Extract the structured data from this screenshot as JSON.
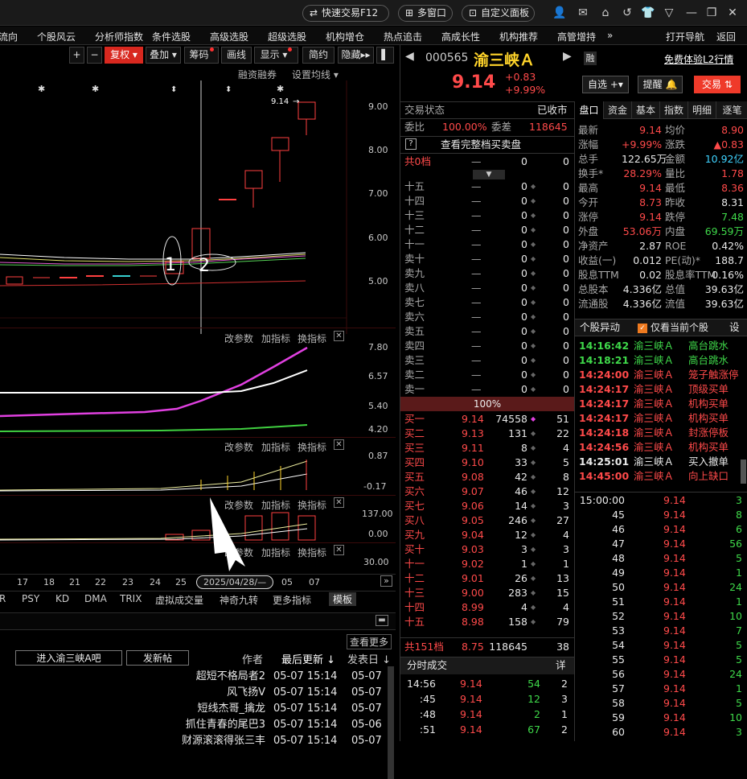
{
  "topbar": {
    "quick_trade": "快速交易F12",
    "multi_window": "多窗口",
    "custom_panel": "自定义面板"
  },
  "menu": [
    "流向",
    "个股风云",
    "分析师指数",
    "条件选股",
    "高级选股",
    "超级选股",
    "机构增仓",
    "热点追击",
    "高成长性",
    "机构推荐",
    "高管增持",
    "»",
    "打开导航",
    "返回"
  ],
  "chart_toolbar": {
    "plus": "+",
    "minus": "−",
    "fuquan": "复权",
    "diejia": "叠加",
    "chouma": "筹码",
    "huaxian": "画线",
    "xianshi": "显示",
    "jianyue": "简约",
    "yincang": "隐藏",
    "rzrq": "融资融券",
    "set_ma": "设置均线"
  },
  "price_axis": [
    "9.00",
    "8.00",
    "7.00",
    "6.00",
    "5.00"
  ],
  "last_price_label": "9.14",
  "annot": {
    "one": "1",
    "two": "2"
  },
  "sub1": {
    "params": "改参数",
    "add": "加指标",
    "swap": "换指标",
    "axis": [
      "7.80",
      "6.57",
      "5.40",
      "4.20"
    ]
  },
  "sub2": {
    "params": "改参数",
    "add": "加指标",
    "swap": "换指标",
    "axis": [
      "0.87",
      "-0.17"
    ]
  },
  "sub3": {
    "params": "改参数",
    "add": "加指标",
    "swap": "换指标",
    "axis": [
      "137.00",
      "0.00"
    ]
  },
  "sub4": {
    "params": "改参数",
    "add": "加指标",
    "swap": "换指标",
    "axis": [
      "30.00"
    ]
  },
  "dates": [
    "17",
    "18",
    "21",
    "22",
    "23",
    "24",
    "25",
    "05",
    "07"
  ],
  "cursor_date": "2025/04/28/—",
  "indicator_tabs": [
    "R",
    "PSY",
    "KD",
    "DMA",
    "TRIX",
    "虚拟成交量",
    "神奇九转",
    "更多指标",
    "模板"
  ],
  "forum": {
    "more": "查看更多",
    "enter": "进入渝三峡A吧",
    "post": "发新帖",
    "col_author": "作者",
    "col_update": "最后更新",
    "col_date": "发表日",
    "rows": [
      [
        "超短不格局者2",
        "05-07 15:14",
        "05-07"
      ],
      [
        "风飞扬V",
        "05-07 15:14",
        "05-07"
      ],
      [
        "短线杰哥_擒龙",
        "05-07 15:14",
        "05-07"
      ],
      [
        "抓住青春的尾巴3",
        "05-07 15:14",
        "05-06"
      ],
      [
        "财源滚滚得张三丰",
        "05-07 15:14",
        "05-07"
      ]
    ]
  },
  "stock": {
    "code": "000565",
    "name": "渝三峡Ａ",
    "price": "9.14",
    "change": "+0.83",
    "pct": "+9.99%",
    "rong": "融",
    "free_l2": "免费体验L2行情",
    "zixuan": "自选",
    "tixing": "提醒",
    "jiaoyi": "交易"
  },
  "trade_status": {
    "label": "交易状态",
    "value": "已收市"
  },
  "weibi": {
    "label": "委比",
    "value": "100.00%",
    "label2": "委差",
    "value2": "118645"
  },
  "full_book": "查看完整档买卖盘",
  "total_top": {
    "label": "共0档",
    "a": "—",
    "b": "0",
    "c": "0"
  },
  "sells": [
    [
      "十五",
      "—",
      "0",
      "0"
    ],
    [
      "十四",
      "—",
      "0",
      "0"
    ],
    [
      "十三",
      "—",
      "0",
      "0"
    ],
    [
      "十二",
      "—",
      "0",
      "0"
    ],
    [
      "十一",
      "—",
      "0",
      "0"
    ],
    [
      "卖十",
      "—",
      "0",
      "0"
    ],
    [
      "卖九",
      "—",
      "0",
      "0"
    ],
    [
      "卖八",
      "—",
      "0",
      "0"
    ],
    [
      "卖七",
      "—",
      "0",
      "0"
    ],
    [
      "卖六",
      "—",
      "0",
      "0"
    ],
    [
      "卖五",
      "—",
      "0",
      "0"
    ],
    [
      "卖四",
      "—",
      "0",
      "0"
    ],
    [
      "卖三",
      "—",
      "0",
      "0"
    ],
    [
      "卖二",
      "—",
      "0",
      "0"
    ],
    [
      "卖一",
      "—",
      "0",
      "0"
    ]
  ],
  "ratio_bar": "100%",
  "buys": [
    [
      "买一",
      "9.14",
      "74558",
      "51"
    ],
    [
      "买二",
      "9.13",
      "131",
      "22"
    ],
    [
      "买三",
      "9.11",
      "8",
      "4"
    ],
    [
      "买四",
      "9.10",
      "33",
      "5"
    ],
    [
      "买五",
      "9.08",
      "42",
      "8"
    ],
    [
      "买六",
      "9.07",
      "46",
      "12"
    ],
    [
      "买七",
      "9.06",
      "14",
      "3"
    ],
    [
      "买八",
      "9.05",
      "246",
      "27"
    ],
    [
      "买九",
      "9.04",
      "12",
      "4"
    ],
    [
      "买十",
      "9.03",
      "3",
      "3"
    ],
    [
      "十一",
      "9.02",
      "1",
      "1"
    ],
    [
      "十二",
      "9.01",
      "26",
      "13"
    ],
    [
      "十三",
      "9.00",
      "283",
      "15"
    ],
    [
      "十四",
      "8.99",
      "4",
      "4"
    ],
    [
      "十五",
      "8.98",
      "158",
      "79"
    ]
  ],
  "total_bottom": {
    "label": "共151档",
    "a": "8.75",
    "b": "118645",
    "c": "38"
  },
  "fenshi": {
    "title": "分时成交",
    "detail": "详",
    "rows": [
      [
        "14:56",
        "9.14",
        "54",
        "2"
      ],
      [
        ":45",
        "9.14",
        "12",
        "3"
      ],
      [
        ":48",
        "9.14",
        "2",
        "1"
      ],
      [
        ":51",
        "9.14",
        "67",
        "2"
      ]
    ]
  },
  "tabs": [
    "盘口",
    "资金",
    "基本",
    "指数",
    "明细",
    "逐笔"
  ],
  "quote": [
    [
      "最新",
      "9.14",
      "均价",
      "8.90"
    ],
    [
      "涨幅",
      "+9.99%",
      "涨跌",
      "▲0.83"
    ],
    [
      "总手",
      "122.65万",
      "金额",
      "10.92亿"
    ],
    [
      "换手*",
      "28.29%",
      "量比",
      "1.78"
    ],
    [
      "最高",
      "9.14",
      "最低",
      "8.36"
    ],
    [
      "今开",
      "8.73",
      "昨收",
      "8.31"
    ],
    [
      "涨停",
      "9.14",
      "跌停",
      "7.48"
    ],
    [
      "外盘",
      "53.06万",
      "内盘",
      "69.59万"
    ],
    [
      "净资产",
      "2.87",
      "ROE",
      "0.42%"
    ],
    [
      "收益(一)",
      "0.012",
      "PE(动)*",
      "188.7"
    ],
    [
      "股息TTM",
      "0.02",
      "股息率TTM",
      "0.16%"
    ],
    [
      "总股本",
      "4.336亿",
      "总值",
      "39.63亿"
    ],
    [
      "流通股",
      "4.336亿",
      "流值",
      "39.63亿"
    ]
  ],
  "anomaly": {
    "title": "个股异动",
    "only_current": "仅看当前个股",
    "settings": "设",
    "rows": [
      [
        "14:16:42",
        "渝三峡Ａ",
        "高台跳水"
      ],
      [
        "14:18:21",
        "渝三峡Ａ",
        "高台跳水"
      ],
      [
        "14:24:00",
        "渝三峡Ａ",
        "笼子触涨停"
      ],
      [
        "14:24:17",
        "渝三峡Ａ",
        "顶级买单"
      ],
      [
        "14:24:17",
        "渝三峡Ａ",
        "机构买单"
      ],
      [
        "14:24:17",
        "渝三峡Ａ",
        "机构买单"
      ],
      [
        "14:24:18",
        "渝三峡Ａ",
        "封涨停板"
      ],
      [
        "14:24:56",
        "渝三峡Ａ",
        "机构买单"
      ],
      [
        "14:25:01",
        "渝三峡Ａ",
        "买入撤单"
      ],
      [
        "14:45:00",
        "渝三峡Ａ",
        "向上缺口"
      ]
    ]
  },
  "ticks": [
    [
      "15:00:00",
      "9.14",
      "3"
    ],
    [
      "45",
      "9.14",
      "8"
    ],
    [
      "46",
      "9.14",
      "6"
    ],
    [
      "47",
      "9.14",
      "56"
    ],
    [
      "48",
      "9.14",
      "5"
    ],
    [
      "49",
      "9.14",
      "1"
    ],
    [
      "50",
      "9.14",
      "24"
    ],
    [
      "51",
      "9.14",
      "1"
    ],
    [
      "52",
      "9.14",
      "10"
    ],
    [
      "53",
      "9.14",
      "7"
    ],
    [
      "54",
      "9.14",
      "5"
    ],
    [
      "55",
      "9.14",
      "5"
    ],
    [
      "56",
      "9.14",
      "24"
    ],
    [
      "57",
      "9.14",
      "1"
    ],
    [
      "58",
      "9.14",
      "5"
    ],
    [
      "59",
      "9.14",
      "10"
    ],
    [
      "60",
      "9.14",
      "3"
    ]
  ]
}
